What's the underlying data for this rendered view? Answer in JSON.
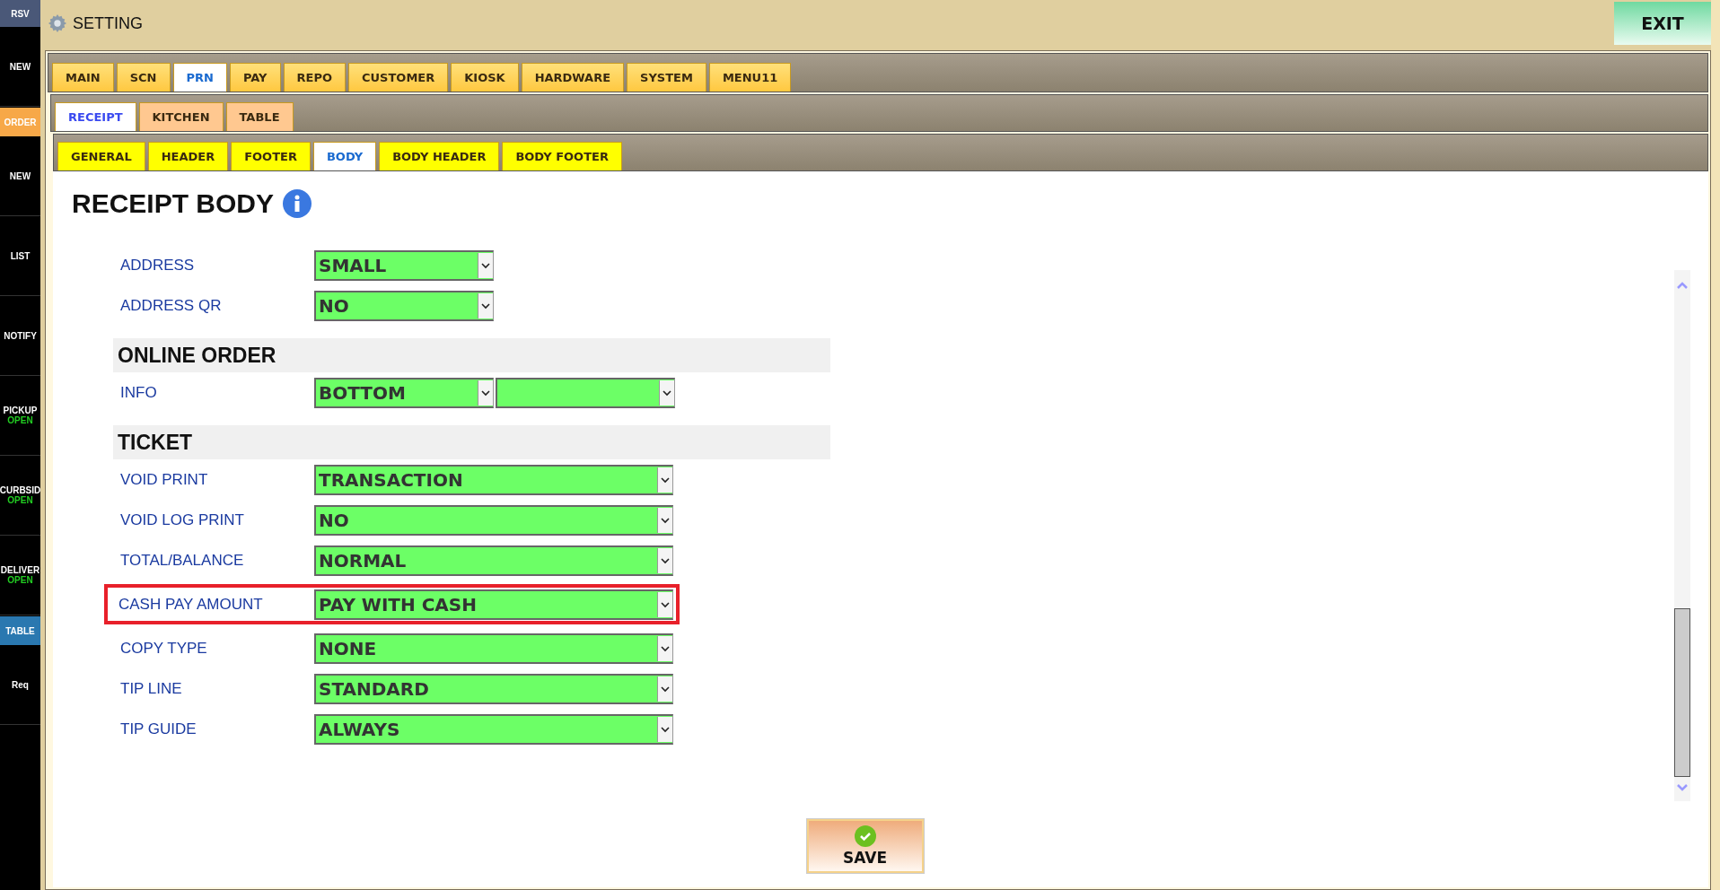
{
  "sidebar": {
    "items": [
      {
        "label": "RSV",
        "kind": "header",
        "color": "#4a5878"
      },
      {
        "label": "NEW",
        "kind": "item"
      },
      {
        "label": "ORDER",
        "kind": "header",
        "color": "#f7a848"
      },
      {
        "label": "NEW",
        "kind": "item"
      },
      {
        "label": "LIST",
        "kind": "item"
      },
      {
        "label": "NOTIFY",
        "kind": "item"
      },
      {
        "label": "PICKUP",
        "kind": "item",
        "status": "OPEN"
      },
      {
        "label": "CURBSID",
        "kind": "item",
        "status": "OPEN"
      },
      {
        "label": "DELIVER",
        "kind": "item",
        "status": "OPEN"
      },
      {
        "label": "TABLE",
        "kind": "header",
        "color": "#2a78b0"
      },
      {
        "label": "Req",
        "kind": "item"
      }
    ]
  },
  "window": {
    "title": "SETTING",
    "exit": "EXIT"
  },
  "tabs": [
    {
      "label": "MAIN",
      "selected": false
    },
    {
      "label": "SCN",
      "selected": false
    },
    {
      "label": "PRN",
      "selected": true
    },
    {
      "label": "PAY",
      "selected": false
    },
    {
      "label": "REPO",
      "selected": false
    },
    {
      "label": "CUSTOMER",
      "selected": false
    },
    {
      "label": "KIOSK",
      "selected": false
    },
    {
      "label": "HARDWARE",
      "selected": false
    },
    {
      "label": "SYSTEM",
      "selected": false
    },
    {
      "label": "MENU11",
      "selected": false
    }
  ],
  "sub_tabs": [
    {
      "label": "RECEIPT",
      "selected": true
    },
    {
      "label": "KITCHEN",
      "selected": false
    },
    {
      "label": "TABLE",
      "selected": false
    }
  ],
  "section_tabs": [
    {
      "label": "GENERAL",
      "selected": false
    },
    {
      "label": "HEADER",
      "selected": false
    },
    {
      "label": "FOOTER",
      "selected": false
    },
    {
      "label": "BODY",
      "selected": true
    },
    {
      "label": "BODY HEADER",
      "selected": false
    },
    {
      "label": "BODY FOOTER",
      "selected": false
    }
  ],
  "heading": "RECEIPT BODY",
  "sections": [
    {
      "rows": [
        {
          "label": "ADDRESS",
          "highlighted": false,
          "selects": [
            {
              "value": "SMALL",
              "kind": "short"
            }
          ]
        },
        {
          "label": "ADDRESS QR",
          "highlighted": false,
          "selects": [
            {
              "value": "NO",
              "kind": "short"
            }
          ]
        }
      ]
    },
    {
      "title": "ONLINE ORDER",
      "rows": [
        {
          "label": "INFO",
          "highlighted": false,
          "selects": [
            {
              "value": "BOTTOM",
              "kind": "short"
            },
            {
              "kind": "short"
            }
          ]
        }
      ]
    },
    {
      "title": "TICKET",
      "rows": [
        {
          "label": "VOID PRINT",
          "highlighted": false,
          "selects": [
            {
              "value": "TRANSACTION",
              "kind": "long"
            }
          ]
        },
        {
          "label": "VOID LOG PRINT",
          "highlighted": false,
          "selects": [
            {
              "value": "NO",
              "kind": "long"
            }
          ]
        },
        {
          "label": "TOTAL/BALANCE",
          "highlighted": false,
          "selects": [
            {
              "value": "NORMAL",
              "kind": "long"
            }
          ]
        },
        {
          "label": "CASH PAY AMOUNT",
          "highlighted": true,
          "selects": [
            {
              "value": "PAY WITH CASH",
              "kind": "long"
            }
          ]
        },
        {
          "label": "COPY TYPE",
          "highlighted": false,
          "selects": [
            {
              "value": "NONE",
              "kind": "long"
            }
          ]
        },
        {
          "label": "TIP LINE",
          "highlighted": false,
          "selects": [
            {
              "value": "STANDARD",
              "kind": "long"
            }
          ]
        },
        {
          "label": "TIP GUIDE",
          "highlighted": false,
          "selects": [
            {
              "value": "ALWAYS",
              "kind": "long"
            }
          ]
        }
      ]
    }
  ],
  "save": "SAVE"
}
